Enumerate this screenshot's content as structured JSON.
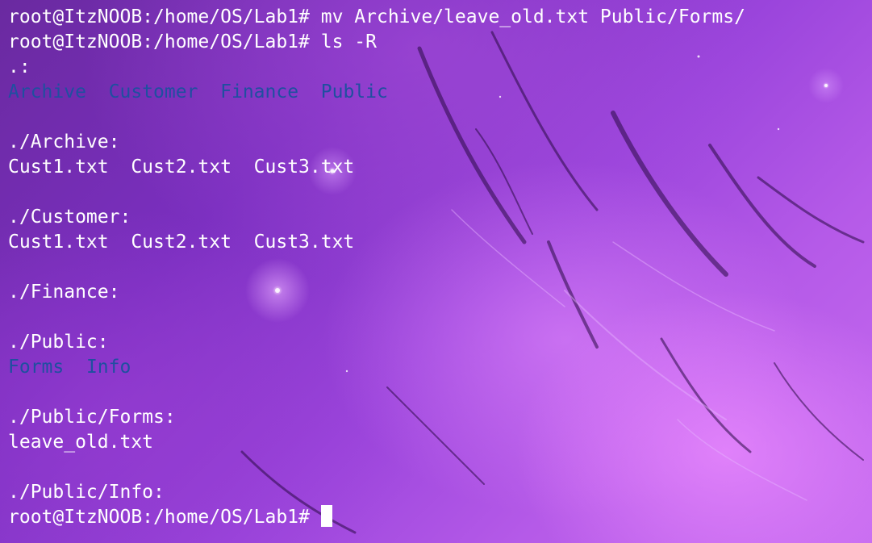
{
  "terminal": {
    "lines": [
      {
        "type": "command",
        "prompt": "root@ItzNOOB:/home/OS/Lab1# ",
        "text": "mv Archive/leave_old.txt Public/Forms/"
      },
      {
        "type": "command",
        "prompt": "root@ItzNOOB:/home/OS/Lab1# ",
        "text": "ls -R"
      },
      {
        "type": "header",
        "text": ".:"
      },
      {
        "type": "dirs",
        "items": [
          "Archive",
          "Customer",
          "Finance",
          "Public"
        ]
      },
      {
        "type": "blank"
      },
      {
        "type": "header",
        "text": "./Archive:"
      },
      {
        "type": "files",
        "items": [
          "Cust1.txt",
          "Cust2.txt",
          "Cust3.txt"
        ]
      },
      {
        "type": "blank"
      },
      {
        "type": "header",
        "text": "./Customer:"
      },
      {
        "type": "files",
        "items": [
          "Cust1.txt",
          "Cust2.txt",
          "Cust3.txt"
        ]
      },
      {
        "type": "blank"
      },
      {
        "type": "header",
        "text": "./Finance:"
      },
      {
        "type": "blank"
      },
      {
        "type": "header",
        "text": "./Public:"
      },
      {
        "type": "dirs",
        "items": [
          "Forms",
          "Info"
        ]
      },
      {
        "type": "blank"
      },
      {
        "type": "header",
        "text": "./Public/Forms:"
      },
      {
        "type": "files",
        "items": [
          "leave_old.txt"
        ]
      },
      {
        "type": "blank"
      },
      {
        "type": "header",
        "text": "./Public/Info:"
      },
      {
        "type": "prompt_active",
        "prompt": "root@ItzNOOB:/home/OS/Lab1# ",
        "text": ""
      }
    ],
    "colors": {
      "text": "#ffffff",
      "directory": "#1f4fa0",
      "background": "#7b2fc0"
    }
  }
}
